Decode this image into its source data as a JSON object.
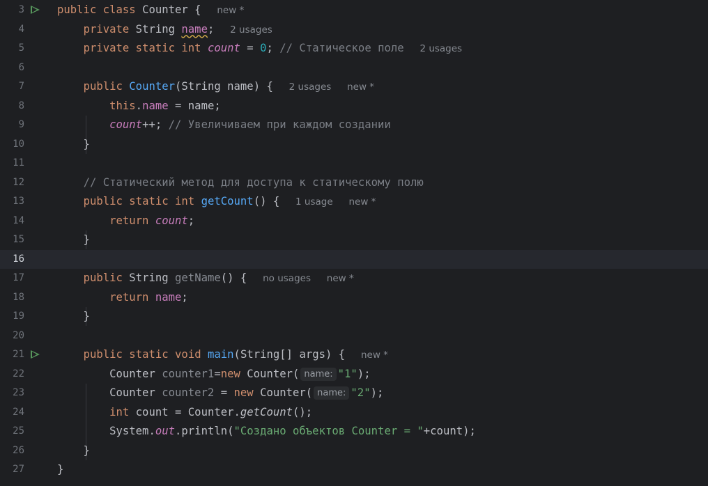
{
  "line_numbers": [
    "3",
    "4",
    "5",
    "6",
    "7",
    "8",
    "9",
    "10",
    "11",
    "12",
    "13",
    "14",
    "15",
    "16",
    "17",
    "18",
    "19",
    "20",
    "21",
    "22",
    "23",
    "24",
    "25",
    "26",
    "27"
  ],
  "current_line": "16",
  "code": {
    "kw_public": "public",
    "kw_private": "private",
    "kw_static": "static",
    "kw_class": "class",
    "kw_int": "int",
    "kw_void": "void",
    "kw_this": "this",
    "kw_return": "return",
    "kw_new": "new",
    "type_string": "String",
    "type_string_arr": "String[]",
    "type_system": "System",
    "class_name": "Counter",
    "field_name": "name",
    "field_count": "count",
    "method_get_count": "getCount",
    "method_get_name": "getName",
    "method_main": "main",
    "param_args": "args",
    "var_counter1": "counter1",
    "var_counter2": "counter2",
    "var_count": "count",
    "field_out": "out",
    "method_println": "println",
    "num_zero": "0",
    "str_one": "\"1\"",
    "str_two": "\"2\"",
    "str_created": "\"Создано объектов Counter = \"",
    "comment_static_field": "// Статическое поле",
    "comment_increment": "// Увеличиваем при каждом создании",
    "comment_static_method": "// Статический метод для доступа к статическому полю"
  },
  "hints": {
    "new_star": "new *",
    "two_usages": "2 usages",
    "one_usage": "1 usage",
    "no_usages": "no usages",
    "param_name": "name:"
  },
  "colors": {
    "background": "#1e1f22",
    "keyword": "#cf8e6d",
    "function": "#56a8f5",
    "field": "#c77dbb",
    "number": "#2aacb8",
    "string": "#6aab73",
    "comment": "#7a7e85",
    "run_icon": "#57965c"
  },
  "icons": {
    "run_gutter": "run-icon"
  }
}
